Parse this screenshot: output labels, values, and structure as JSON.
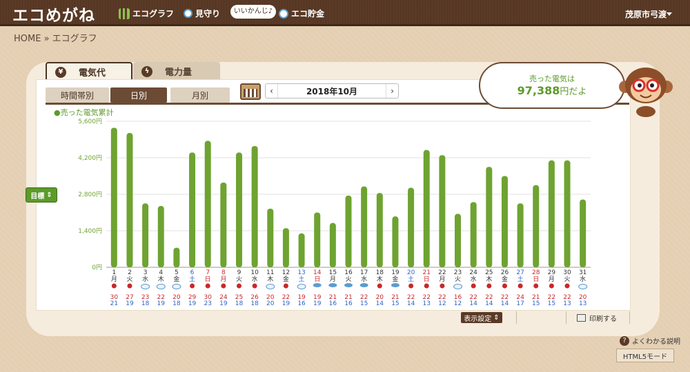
{
  "header": {
    "logo": "エコめがね",
    "nav": [
      {
        "label": "エコグラフ",
        "icon": "bar-chart-icon"
      },
      {
        "label": "見守り",
        "icon": "magnifier-icon"
      },
      {
        "label": "エコ貯金",
        "icon": "coin-icon"
      }
    ],
    "bubble": "いいかんじ♪",
    "user": "茂原市弓渡"
  },
  "breadcrumb": "HOME » エコグラフ",
  "tabs": {
    "electricity_cost": "電気代",
    "electricity_amount": "電力量"
  },
  "period_tabs": [
    "時間帯別",
    "日別",
    "月別"
  ],
  "date_nav": {
    "prev": "‹",
    "next": "›",
    "date": "2018年10月"
  },
  "callout": {
    "line1": "売った電気は",
    "amount": "97,388",
    "suffix": "円だよ"
  },
  "legend": "●売った電気累計",
  "goal_button": "目標",
  "controls": {
    "display_settings": "表示設定",
    "print": "印刷する",
    "help": "よくわかる説明",
    "html5": "HTML5モード"
  },
  "colors": {
    "bar": "#6ea331",
    "axis_text": "#6ea331",
    "weekday": "#333333",
    "saturday": "#2a64c8",
    "sunday": "#c8282a",
    "high_temp": "#c8282a",
    "low_temp": "#2a64c8"
  },
  "chart_data": {
    "type": "bar",
    "ylabel": "",
    "ylim": [
      0,
      5600
    ],
    "yticks": [
      0,
      1400,
      2800,
      4200,
      5600
    ],
    "ytick_labels": [
      "0円",
      "1,400円",
      "2,800円",
      "4,200円",
      "5,600円"
    ],
    "categories": [
      "1",
      "2",
      "3",
      "4",
      "5",
      "6",
      "7",
      "8",
      "9",
      "10",
      "11",
      "12",
      "13",
      "14",
      "15",
      "16",
      "17",
      "18",
      "19",
      "20",
      "21",
      "22",
      "23",
      "24",
      "25",
      "26",
      "27",
      "28",
      "29",
      "30",
      "31"
    ],
    "weekdays": [
      "月",
      "火",
      "水",
      "木",
      "金",
      "土",
      "日",
      "月",
      "火",
      "水",
      "木",
      "金",
      "土",
      "日",
      "月",
      "火",
      "水",
      "木",
      "金",
      "土",
      "日",
      "月",
      "火",
      "水",
      "木",
      "金",
      "土",
      "日",
      "月",
      "火",
      "水"
    ],
    "day_colors": [
      "w",
      "w",
      "w",
      "w",
      "w",
      "sat",
      "sun",
      "sun",
      "w",
      "w",
      "w",
      "w",
      "sat",
      "sun",
      "w",
      "w",
      "w",
      "w",
      "w",
      "sat",
      "sun",
      "w",
      "w",
      "w",
      "w",
      "w",
      "sat",
      "sun",
      "w",
      "w",
      "w"
    ],
    "values": [
      5350,
      5150,
      2450,
      2350,
      750,
      4400,
      4850,
      3250,
      4400,
      4650,
      2250,
      1500,
      1300,
      2100,
      1700,
      2750,
      3100,
      2850,
      1950,
      3050,
      4500,
      4300,
      2050,
      2500,
      3850,
      3500,
      2450,
      3150,
      4100,
      4100,
      2600
    ],
    "weather": [
      "sun",
      "sun",
      "cloud",
      "cloud",
      "cloud",
      "sun",
      "sun",
      "sun",
      "sun",
      "sun",
      "cloud",
      "sun",
      "cloud",
      "rain",
      "rain",
      "rain",
      "rain",
      "sun",
      "rain",
      "sun",
      "sun",
      "sun",
      "cloud",
      "sun",
      "sun",
      "sun",
      "sun",
      "sun",
      "sun",
      "sun",
      "cloud"
    ],
    "high_temps": [
      "30",
      "27",
      "23",
      "22",
      "20",
      "29",
      "30",
      "24",
      "25",
      "26",
      "20",
      "22",
      "19",
      "19",
      "21",
      "21",
      "22",
      "20",
      "21",
      "22",
      "22",
      "22",
      "16",
      "22",
      "22",
      "22",
      "24",
      "21",
      "22",
      "22",
      "20"
    ],
    "low_temps": [
      "21",
      "19",
      "18",
      "19",
      "18",
      "19",
      "23",
      "19",
      "18",
      "18",
      "20",
      "19",
      "16",
      "19",
      "16",
      "16",
      "15",
      "14",
      "15",
      "14",
      "13",
      "12",
      "12",
      "14",
      "14",
      "14",
      "17",
      "15",
      "15",
      "13",
      "13"
    ]
  }
}
